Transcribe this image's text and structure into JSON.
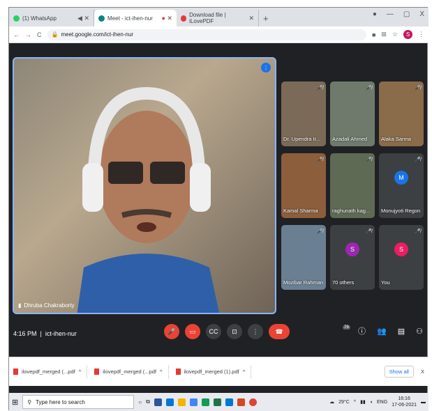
{
  "tabs": [
    {
      "label": "(1) WhatsApp",
      "fav_color": "#25d366"
    },
    {
      "label": "Meet - ict-ihen-nur",
      "fav_color": "#00897b"
    },
    {
      "label": "Download file | iLovePDF",
      "fav_color": "#e53935"
    }
  ],
  "window_controls": [
    "—",
    "▢",
    "X"
  ],
  "url": "meet.google.com/ict-ihen-nur",
  "profile_initial": "S",
  "main_speaker": "Dhruba Chakraborty",
  "participants": [
    {
      "name": "Dr. Upendra Ir...",
      "bg": "#7b6a58"
    },
    {
      "name": "Azadali Ahmed",
      "bg": "#6f7a6c"
    },
    {
      "name": "Alaka Sarma",
      "bg": "#8a6b4a"
    },
    {
      "name": "Kamal Sharma",
      "bg": "#8c5e3c"
    },
    {
      "name": "raghunath kag...",
      "bg": "#5f6a55"
    },
    {
      "name": "Monujyoti Regon",
      "avatar": "M",
      "avatar_color": "#1a73e8",
      "bg": "#3c4043"
    },
    {
      "name": "Mozibar Rahman",
      "bg": "#6b7f93"
    },
    {
      "name": "70 others",
      "avatar": "S",
      "avatar_color": "#9c27b0",
      "bg": "#3c4043"
    },
    {
      "name": "You",
      "avatar": "S",
      "avatar_color": "#e91e63",
      "bg": "#3c4043"
    }
  ],
  "meeting_time": "4:16 PM",
  "meeting_code": "ict-ihen-nur",
  "people_count": "79",
  "downloads": [
    "ilovepdf_merged (...pdf",
    "ilovepdf_merged (...pdf",
    "ilovepdf_merged (1).pdf"
  ],
  "show_all": "Show all",
  "taskbar": {
    "search_placeholder": "Type here to search",
    "weather": "29°C",
    "lang": "ENG",
    "time": "16:16",
    "date": "17-06-2021"
  },
  "colors": {
    "meet_bg": "#202124",
    "accent": "#8ab4f8",
    "hangup": "#ea4335"
  }
}
